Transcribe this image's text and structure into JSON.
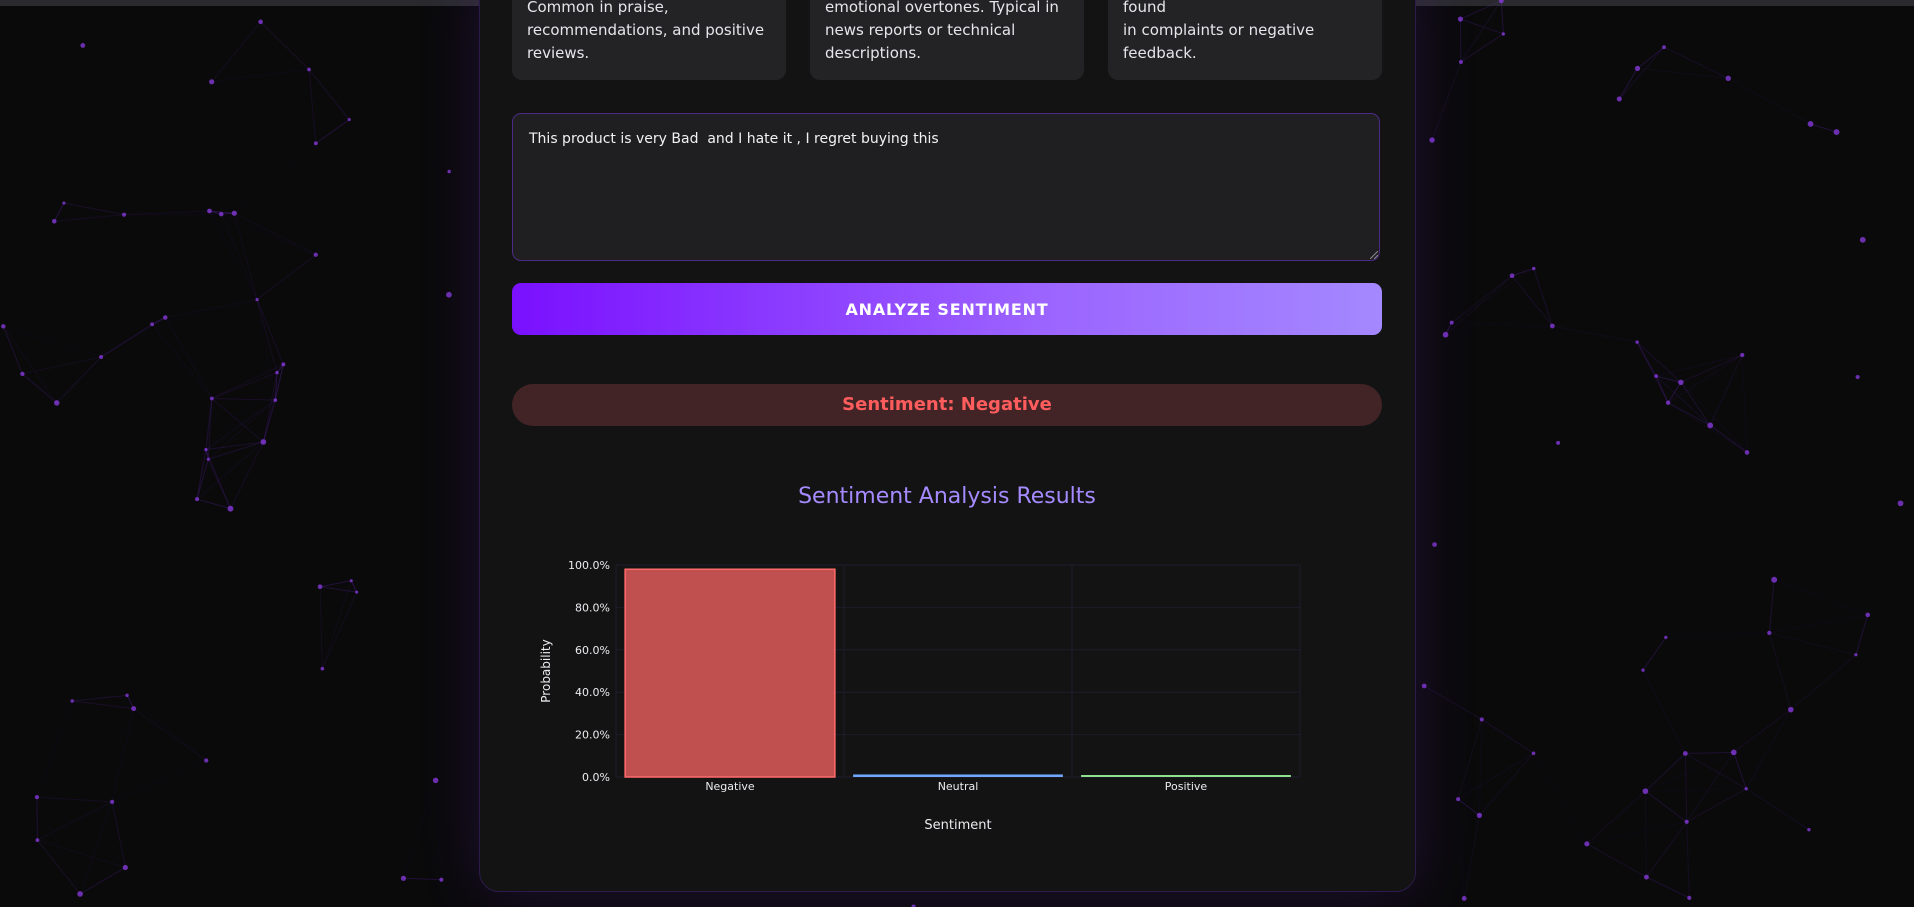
{
  "info_cards": [
    {
      "lines": [
        "Common in praise,",
        "recommendations, and positive",
        "reviews."
      ]
    },
    {
      "lines": [
        "emotional overtones. Typical in",
        "news reports or technical",
        "descriptions."
      ]
    },
    {
      "lines": [
        "criticism, or pessimism. Often found",
        "in complaints or negative feedback."
      ]
    }
  ],
  "input": {
    "value": "This product is very Bad  and I hate it , I regret buying this"
  },
  "analyze_button": {
    "label": "ANALYZE SENTIMENT"
  },
  "result": {
    "text": "Sentiment: Negative",
    "color": "#ff5d5d"
  },
  "colors": {
    "accent": "#8a2be2",
    "negative": "#c04f4f",
    "neutral": "#6fa8ff",
    "positive": "#8fe08f"
  },
  "chart_data": {
    "type": "bar",
    "title": "Sentiment Analysis Results",
    "xlabel": "Sentiment",
    "ylabel": "Probability",
    "categories": [
      "Negative",
      "Neutral",
      "Positive"
    ],
    "values": [
      0.98,
      0.012,
      0.008
    ],
    "ylim": [
      0,
      1
    ],
    "yticks": [
      "0.0%",
      "20.0%",
      "40.0%",
      "60.0%",
      "80.0%",
      "100.0%"
    ],
    "bar_colors": [
      "#c04f4f",
      "#6fa8ff",
      "#8fe08f"
    ],
    "grid": true
  }
}
